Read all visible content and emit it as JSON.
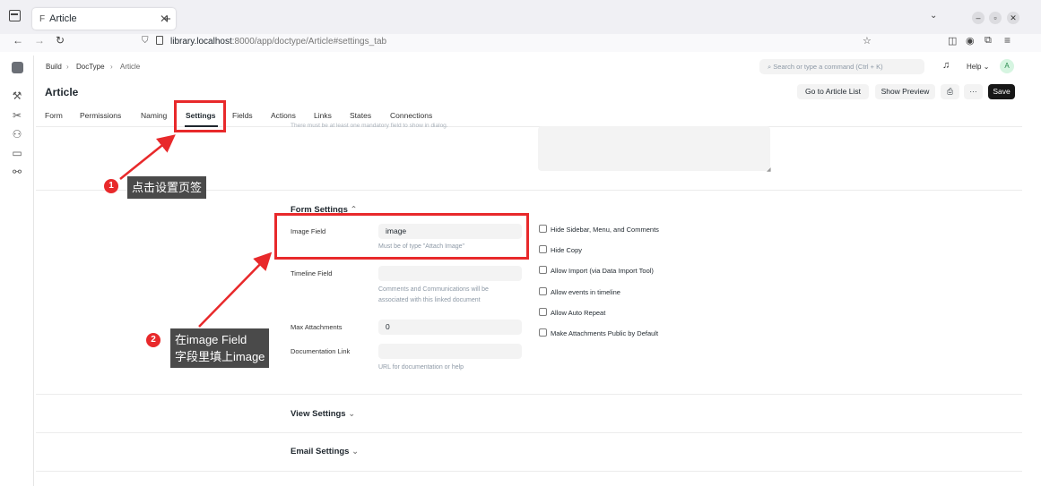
{
  "browser": {
    "tab_title": "Article",
    "tab_favicon": "F",
    "url_host": "library.localhost",
    "url_path": ":8000/app/doctype/Article#settings_tab"
  },
  "app": {
    "breadcrumb": [
      "Build",
      "DocType",
      "Article"
    ],
    "search_placeholder": "Search or type a command (Ctrl + K)",
    "help_label": "Help",
    "avatar_letter": "A",
    "page_title": "Article",
    "buttons": {
      "go_to_list": "Go to Article List",
      "preview": "Show Preview",
      "more": "···",
      "save": "Save"
    },
    "tabs": [
      "Form",
      "Permissions",
      "Naming",
      "Settings",
      "Fields",
      "Actions",
      "Links",
      "States",
      "Connections"
    ],
    "active_tab": "Settings",
    "top_hint": "There must be at least one mandatory field to show in dialog."
  },
  "form_settings": {
    "title": "Form Settings",
    "image_field": {
      "label": "Image Field",
      "value": "image",
      "hint": "Must be of type \"Attach Image\""
    },
    "timeline_field": {
      "label": "Timeline Field",
      "value": "",
      "hint_line1": "Comments and Communications will be",
      "hint_line2": "associated with this linked document"
    },
    "max_attachments": {
      "label": "Max Attachments",
      "value": "0"
    },
    "documentation_link": {
      "label": "Documentation Link",
      "value": "",
      "hint": "URL for documentation or help"
    },
    "checkboxes": [
      "Hide Sidebar, Menu, and Comments",
      "Hide Copy",
      "Allow Import (via Data Import Tool)",
      "Allow events in timeline",
      "Allow Auto Repeat",
      "Make Attachments Public by Default"
    ]
  },
  "view_settings": {
    "title": "View Settings"
  },
  "email_settings": {
    "title": "Email Settings"
  },
  "annotations": {
    "step1": {
      "number": "1",
      "text": "点击设置页签"
    },
    "step2": {
      "number": "2",
      "line1": "在image Field",
      "line2": "字段里填上image"
    }
  },
  "colors": {
    "annotation_red": "#e8292b",
    "callout_bg": "#4a4a4a",
    "save_bg": "#171717"
  }
}
